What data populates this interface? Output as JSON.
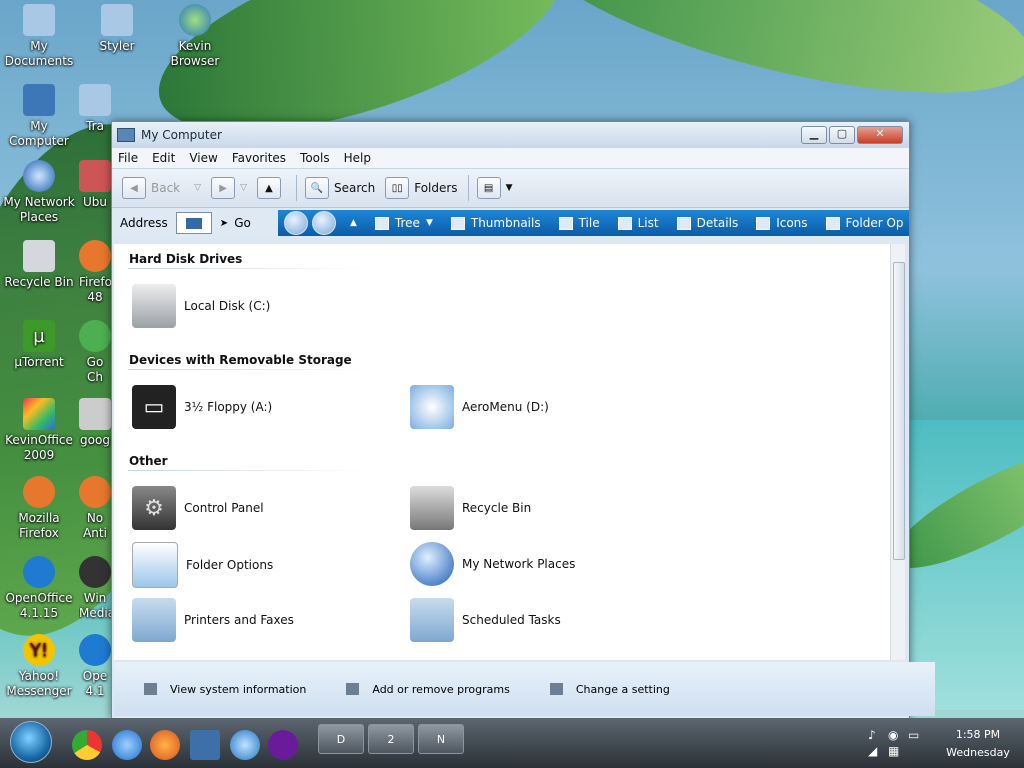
{
  "desktop": {
    "icons": [
      {
        "label": "My Documents",
        "icon": "folder-icon"
      },
      {
        "label": "Styler",
        "icon": "folder-icon"
      },
      {
        "label": "Kevin Browser",
        "icon": "globe-icon"
      },
      {
        "label": "My Computer",
        "icon": "computer-icon"
      },
      {
        "label": "Tra",
        "icon": "folder-icon"
      },
      {
        "label": "My Network Places",
        "icon": "network-icon"
      },
      {
        "label": "Ubu",
        "icon": "app-icon"
      },
      {
        "label": "Recycle Bin",
        "icon": "recycle-bin-icon"
      },
      {
        "label": "Firefo 48",
        "icon": "firefox-icon"
      },
      {
        "label": "µTorrent",
        "icon": "utorrent-icon"
      },
      {
        "label": "Go Ch",
        "icon": "chrome-icon"
      },
      {
        "label": "KevinOffice 2009",
        "icon": "office-icon"
      },
      {
        "label": "goog",
        "icon": "app-icon"
      },
      {
        "label": "Mozilla Firefox",
        "icon": "firefox-icon"
      },
      {
        "label": "No Anti",
        "icon": "app-icon"
      },
      {
        "label": "OpenOffice 4.1.15",
        "icon": "openoffice-icon"
      },
      {
        "label": "Win Media",
        "icon": "media-icon"
      },
      {
        "label": "Yahoo! Messenger",
        "icon": "yahoo-icon"
      },
      {
        "label": "Ope 4.1",
        "icon": "openoffice-icon"
      }
    ]
  },
  "window": {
    "title": "My Computer",
    "menu": [
      "File",
      "Edit",
      "View",
      "Favorites",
      "Tools",
      "Help"
    ],
    "toolbar": {
      "back": "Back",
      "search": "Search",
      "folders": "Folders"
    },
    "address": {
      "label": "Address",
      "go": "Go"
    },
    "views": [
      "Tree",
      "Thumbnails",
      "Tile",
      "List",
      "Details",
      "Icons",
      "Folder Op"
    ],
    "groups": [
      {
        "title": "Hard Disk Drives",
        "items": [
          "Local Disk (C:)"
        ]
      },
      {
        "title": "Devices with Removable Storage",
        "items": [
          "3½ Floppy (A:)",
          "AeroMenu (D:)"
        ]
      },
      {
        "title": "Other",
        "items": [
          "Control Panel",
          "Recycle Bin",
          "Folder Options",
          "My Network Places",
          "Printers and Faxes",
          "Scheduled Tasks"
        ]
      }
    ],
    "tasks": [
      "View system information",
      "Add or remove programs",
      "Change a setting"
    ]
  },
  "taskbar": {
    "buttons": [
      "D",
      "2",
      "N"
    ],
    "time": "1:58 PM",
    "day": "Wednesday"
  },
  "colors": {
    "viewbar": "#0b5ca8",
    "window_bg": "#dce8f4"
  }
}
